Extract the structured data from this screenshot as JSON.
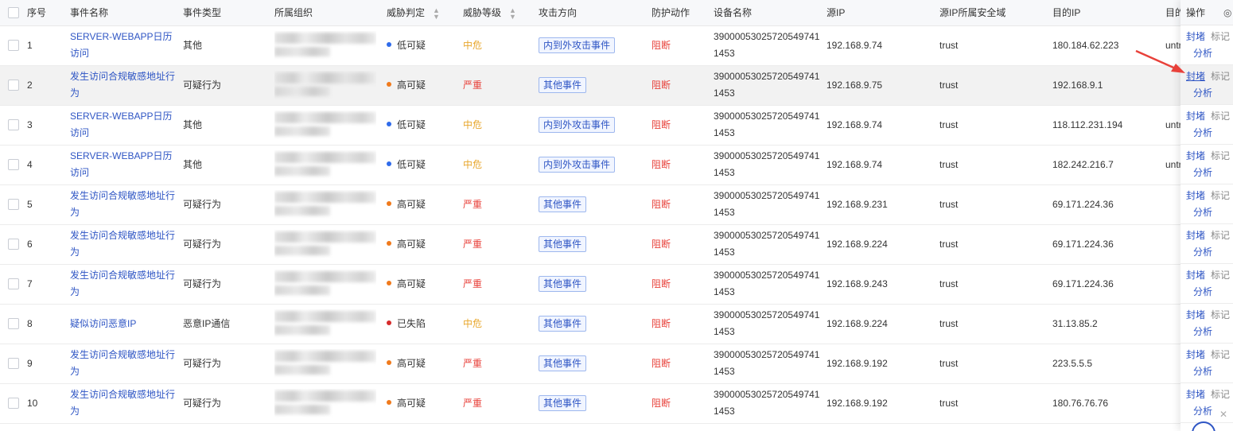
{
  "columns": [
    "序号",
    "事件名称",
    "事件类型",
    "所属组织",
    "威胁判定",
    "威胁等级",
    "攻击方向",
    "防护动作",
    "设备名称",
    "源IP",
    "源IP所属安全域",
    "目的IP",
    "目的"
  ],
  "ops_header": "操作",
  "ops_icon": "gear-icon",
  "ops_labels": {
    "block": "封堵",
    "mark": "标记",
    "analyze": "分析"
  },
  "colors": {
    "link": "#2e55c4",
    "red": "#e8413a",
    "orange": "#f07a1c",
    "blue": "#2f6bea",
    "darkred": "#d62b2b",
    "mid": "#e8a72c"
  },
  "rows": [
    {
      "no": "1",
      "name": "SERVER-WEBAPP日历访问",
      "type": "其他",
      "judge": "低可疑",
      "judge_color": "#2f6bea",
      "level": "中危",
      "level_cls": "lvl-mid",
      "direction": "内到外攻击事件",
      "action": "阻断",
      "device": "39000053025720549741 1453",
      "src": "192.168.9.74",
      "zone": "trust",
      "dst": "180.184.62.223",
      "dst_zone": "untr"
    },
    {
      "no": "2",
      "name": "发生访问合规敏感地址行为",
      "type": "可疑行为",
      "judge": "高可疑",
      "judge_color": "#f07a1c",
      "level": "严重",
      "level_cls": "lvl-sev",
      "direction": "其他事件",
      "action": "阻断",
      "device": "39000053025720549741 1453",
      "src": "192.168.9.75",
      "zone": "trust",
      "dst": "192.168.9.1",
      "dst_zone": ""
    },
    {
      "no": "3",
      "name": "SERVER-WEBAPP日历访问",
      "type": "其他",
      "judge": "低可疑",
      "judge_color": "#2f6bea",
      "level": "中危",
      "level_cls": "lvl-mid",
      "direction": "内到外攻击事件",
      "action": "阻断",
      "device": "39000053025720549741 1453",
      "src": "192.168.9.74",
      "zone": "trust",
      "dst": "118.112.231.194",
      "dst_zone": "untr"
    },
    {
      "no": "4",
      "name": "SERVER-WEBAPP日历访问",
      "type": "其他",
      "judge": "低可疑",
      "judge_color": "#2f6bea",
      "level": "中危",
      "level_cls": "lvl-mid",
      "direction": "内到外攻击事件",
      "action": "阻断",
      "device": "39000053025720549741 1453",
      "src": "192.168.9.74",
      "zone": "trust",
      "dst": "182.242.216.7",
      "dst_zone": "untr"
    },
    {
      "no": "5",
      "name": "发生访问合规敏感地址行为",
      "type": "可疑行为",
      "judge": "高可疑",
      "judge_color": "#f07a1c",
      "level": "严重",
      "level_cls": "lvl-sev",
      "direction": "其他事件",
      "action": "阻断",
      "device": "39000053025720549741 1453",
      "src": "192.168.9.231",
      "zone": "trust",
      "dst": "69.171.224.36",
      "dst_zone": ""
    },
    {
      "no": "6",
      "name": "发生访问合规敏感地址行为",
      "type": "可疑行为",
      "judge": "高可疑",
      "judge_color": "#f07a1c",
      "level": "严重",
      "level_cls": "lvl-sev",
      "direction": "其他事件",
      "action": "阻断",
      "device": "39000053025720549741 1453",
      "src": "192.168.9.224",
      "zone": "trust",
      "dst": "69.171.224.36",
      "dst_zone": ""
    },
    {
      "no": "7",
      "name": "发生访问合规敏感地址行为",
      "type": "可疑行为",
      "judge": "高可疑",
      "judge_color": "#f07a1c",
      "level": "严重",
      "level_cls": "lvl-sev",
      "direction": "其他事件",
      "action": "阻断",
      "device": "39000053025720549741 1453",
      "src": "192.168.9.243",
      "zone": "trust",
      "dst": "69.171.224.36",
      "dst_zone": ""
    },
    {
      "no": "8",
      "name": "疑似访问恶意IP",
      "type": "恶意IP通信",
      "judge": "已失陷",
      "judge_color": "#d62b2b",
      "level": "中危",
      "level_cls": "lvl-mid",
      "direction": "其他事件",
      "action": "阻断",
      "device": "39000053025720549741 1453",
      "src": "192.168.9.224",
      "zone": "trust",
      "dst": "31.13.85.2",
      "dst_zone": ""
    },
    {
      "no": "9",
      "name": "发生访问合规敏感地址行为",
      "type": "可疑行为",
      "judge": "高可疑",
      "judge_color": "#f07a1c",
      "level": "严重",
      "level_cls": "lvl-sev",
      "direction": "其他事件",
      "action": "阻断",
      "device": "39000053025720549741 1453",
      "src": "192.168.9.192",
      "zone": "trust",
      "dst": "223.5.5.5",
      "dst_zone": ""
    },
    {
      "no": "10",
      "name": "发生访问合规敏感地址行为",
      "type": "可疑行为",
      "judge": "高可疑",
      "judge_color": "#f07a1c",
      "level": "严重",
      "level_cls": "lvl-sev",
      "direction": "其他事件",
      "action": "阻断",
      "device": "39000053025720549741 1453",
      "src": "192.168.9.192",
      "zone": "trust",
      "dst": "180.76.76.76",
      "dst_zone": ""
    }
  ]
}
